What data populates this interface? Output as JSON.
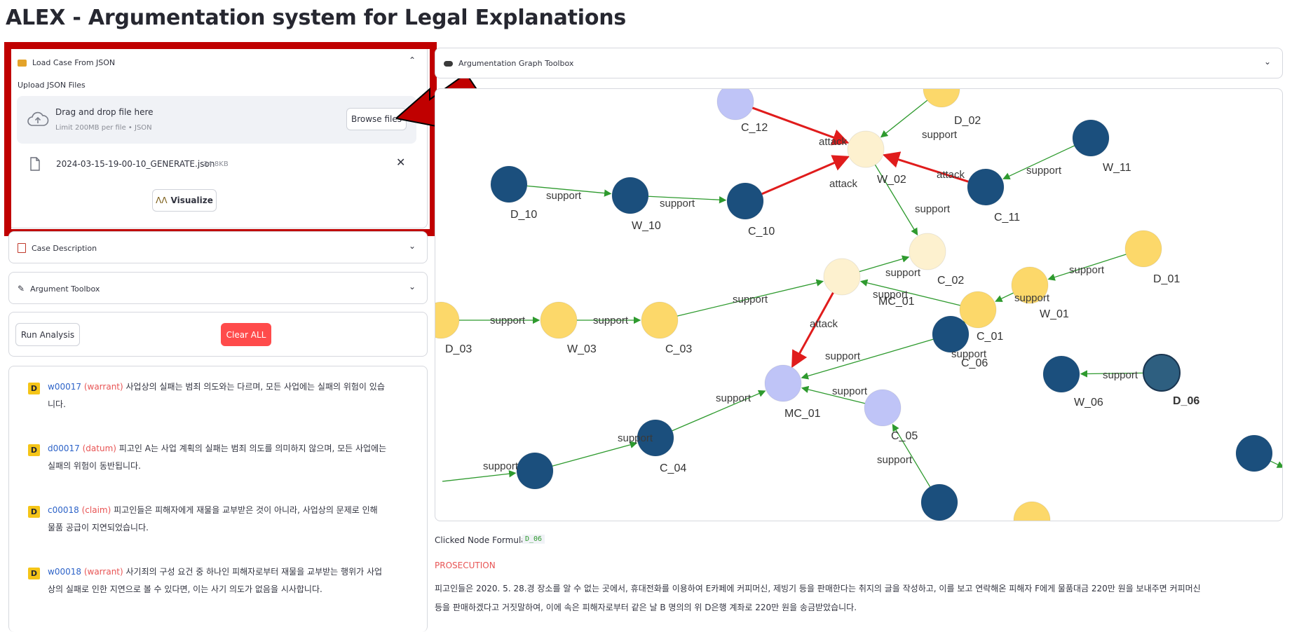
{
  "app": {
    "title": "ALEX - Argumentation system for Legal Explanations"
  },
  "sidebar": {
    "load_case": {
      "header": "Load Case From JSON",
      "upload_label": "Upload JSON Files",
      "drop_text": "Drag and drop file here",
      "limit_text": "Limit 200MB per file • JSON",
      "browse_label": "Browse files",
      "file_name": "2024-03-15-19-00-10_GENERATE.json",
      "file_size": "34.8KB",
      "visualize_label": "Visualize"
    },
    "case_description": {
      "header": "Case Description"
    },
    "argument_toolbox": {
      "header": "Argument Toolbox"
    },
    "run_analysis_label": "Run Analysis",
    "clear_all_label": "Clear ALL",
    "arguments": [
      {
        "badge": "D",
        "id": "w00017",
        "kind": "(warrant)",
        "line1": "사업상의 실패는 범죄 의도와는 다르며, 모든 사업에는 실패의 위험이 있습",
        "line2": "니다."
      },
      {
        "badge": "D",
        "id": "d00017",
        "kind": "(datum)",
        "line1": "피고인 A는 사업 계획의 실패는 범죄 의도를 의미하지 않으며, 모든 사업에는",
        "line2": "실패의 위험이 동반됩니다."
      },
      {
        "badge": "D",
        "id": "c00018",
        "kind": "(claim)",
        "line1": "피고인들은 피해자에게 재물을 교부받은 것이 아니라, 사업상의 문제로 인해",
        "line2": "물품 공급이 지연되었습니다."
      },
      {
        "badge": "D",
        "id": "w00018",
        "kind": "(warrant)",
        "line1": "사기죄의 구성 요건 중 하나인 피해자로부터 재물을 교부받는 행위가 사업",
        "line2": "상의 실패로 인한 지연으로 볼 수 있다면, 이는 사기 의도가 없음을 시사합니다."
      }
    ]
  },
  "graph_toolbox": {
    "header": "Argumentation Graph Toolbox"
  },
  "graph": {
    "colors": {
      "datum": "#1b4f7d",
      "datum_selected": "#2e5f80",
      "warrant": "#fcd86a",
      "claim": "#fdf1cf",
      "main_claim": "#bfc4f7",
      "support": "#2e9a2e",
      "attack": "#e01c1c"
    },
    "nodes": [
      {
        "label": "C_12",
        "type": "main_claim"
      },
      {
        "label": "D_02",
        "type": "warrant"
      },
      {
        "label": "W_02",
        "type": "claim"
      },
      {
        "label": "W_11",
        "type": "datum"
      },
      {
        "label": "D_10",
        "type": "datum"
      },
      {
        "label": "W_10",
        "type": "datum"
      },
      {
        "label": "C_10",
        "type": "datum"
      },
      {
        "label": "C_11",
        "type": "datum"
      },
      {
        "label": "C_02",
        "type": "claim"
      },
      {
        "label": "MC_01",
        "type": "claim"
      },
      {
        "label": "D_01",
        "type": "warrant"
      },
      {
        "label": "W_01",
        "type": "warrant"
      },
      {
        "label": "C_01",
        "type": "warrant"
      },
      {
        "label": "D_03",
        "type": "warrant"
      },
      {
        "label": "W_03",
        "type": "warrant"
      },
      {
        "label": "C_03",
        "type": "warrant"
      },
      {
        "label": "C_06",
        "type": "datum"
      },
      {
        "label": "W_06",
        "type": "datum"
      },
      {
        "label": "D_06",
        "type": "datum_selected"
      },
      {
        "label": "MC_01",
        "type": "main_claim"
      },
      {
        "label": "C_05",
        "type": "main_claim"
      },
      {
        "label": "C_04",
        "type": "datum"
      },
      {
        "label": "",
        "type": "datum"
      },
      {
        "label": "",
        "type": "datum"
      },
      {
        "label": "",
        "type": "warrant"
      },
      {
        "label": "",
        "type": "datum"
      }
    ],
    "edge_labels": {
      "support": "support",
      "attack": "attack"
    }
  },
  "details": {
    "formula_label": "Clicked Node Formula:",
    "formula_value": "D_06",
    "section_label": "PROSECUTION",
    "paragraph_line1": "피고인들은 2020. 5. 28.경 장소를 알 수 없는 곳에서, 휴대전화를 이용하여 E카페에 커피머신, 제빙기 등을 판매한다는 취지의 글을 작성하고, 이를 보고 연락해온 피해자 F에게 물품대금 220만 원을 보내주면 커피머신",
    "paragraph_line2": "등을 판매하겠다고 거짓말하여, 이에 속은 피해자로부터 같은 날 B 명의의 위 D은행 계좌로 220만 원을 송금받았습니다."
  }
}
